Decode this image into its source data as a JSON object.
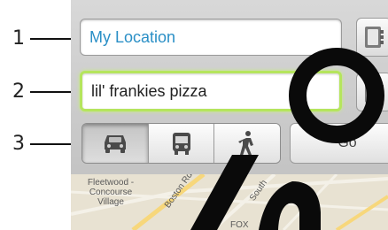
{
  "callouts": [
    "1",
    "2",
    "3"
  ],
  "directions": {
    "from_value": "My Location",
    "to_value": "lil' frankies pizza",
    "go_label": "Go",
    "modes": [
      {
        "icon": "car-icon",
        "selected": true
      },
      {
        "icon": "bus-icon",
        "selected": false
      },
      {
        "icon": "walk-icon",
        "selected": false
      }
    ]
  },
  "map": {
    "labels": [
      "Fleetwood - Concourse Village",
      "Boston Rd",
      "South",
      "FOX"
    ]
  },
  "colors": {
    "from_text": "#2a8fc6",
    "focus_border": "#b5e55d",
    "background": "#ffffff"
  }
}
